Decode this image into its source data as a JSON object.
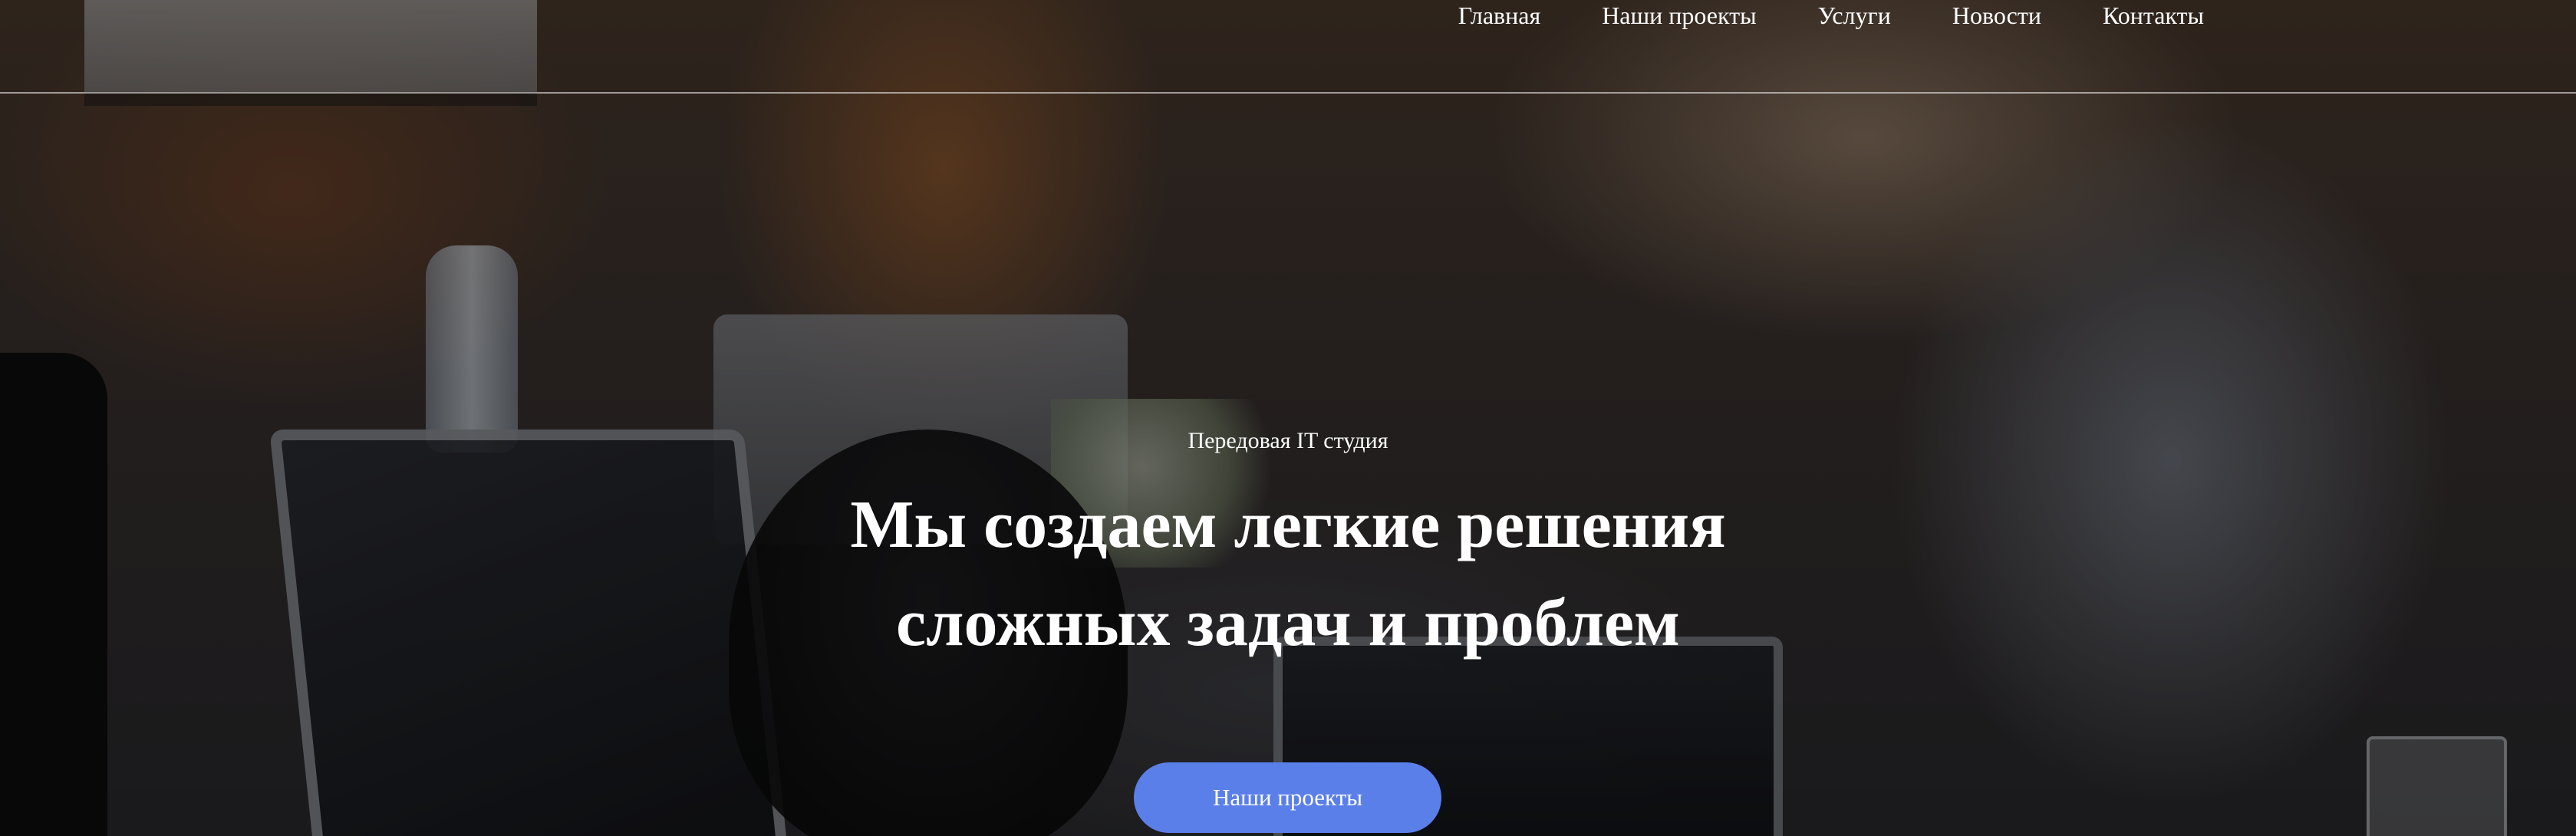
{
  "nav": {
    "items": [
      {
        "label": "Главная"
      },
      {
        "label": "Наши проекты"
      },
      {
        "label": "Услуги"
      },
      {
        "label": "Новости"
      },
      {
        "label": "Контакты"
      }
    ]
  },
  "hero": {
    "eyebrow": "Передовая IT студия",
    "headline_line1": "Мы создаем легкие решения",
    "headline_line2": "сложных задач и проблем",
    "cta_label": "Наши проекты"
  },
  "colors": {
    "cta_background": "#5b7fe8",
    "text": "#ffffff",
    "overlay": "rgba(0,0,0,0.38)"
  }
}
